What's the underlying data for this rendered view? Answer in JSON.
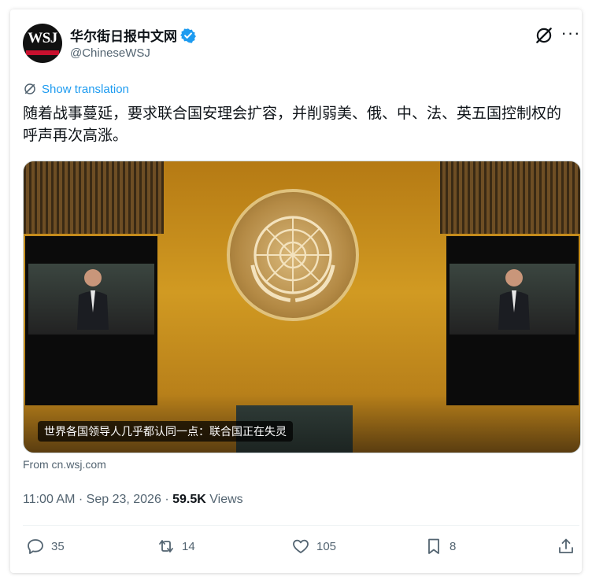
{
  "account": {
    "display_name": "华尔街日报中文网",
    "handle": "@ChineseWSJ",
    "avatar_text": "WSJ"
  },
  "translate_label": "Show translation",
  "tweet_text": "随着战事蔓延，要求联合国安理会扩容，并削弱美、俄、中、法、英五国控制权的呼声再次高涨。",
  "media": {
    "caption": "世界各国领导人几乎都认同一点：联合国正在失灵"
  },
  "link_source": "From cn.wsj.com",
  "meta": {
    "time": "11:00 AM",
    "separator": "·",
    "date": "Sep 23, 2026",
    "views_count": "59.5K",
    "views_label": "Views"
  },
  "actions": {
    "replies": "35",
    "reposts": "14",
    "likes": "105",
    "bookmarks": "8"
  },
  "colors": {
    "accent": "#1d9bf0",
    "secondary_text": "#536471",
    "primary_text": "#0f1419"
  }
}
